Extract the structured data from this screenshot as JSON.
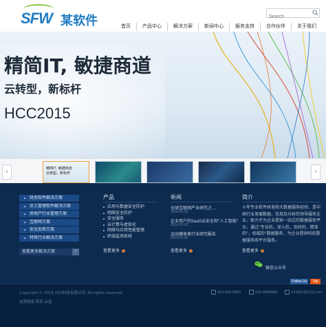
{
  "header": {
    "logo_text": "SFW",
    "brand_name": "某软件",
    "search_placeholder": "Search",
    "nav": [
      "首页",
      "产品中心",
      "解决方案",
      "新闻中心",
      "服务支持",
      "合作伙伴",
      "关于我们"
    ]
  },
  "banner": {
    "title": "精简IT, 敏捷商道",
    "subtitle": "云转型，新标杆",
    "code": "HCC2015"
  },
  "thumbnails": {
    "prev_label": "‹",
    "next_label": "›",
    "first_caption": [
      "精简IT, 敏捷商道",
      "云转型，新标杆"
    ]
  },
  "solutions": {
    "items": [
      "财务软件解决方案",
      "员工管理软件解决方案",
      "房地产行业管理方案",
      "互联网方案",
      "安全加密方案",
      "特殊行业解决方案"
    ],
    "more_label": "查看更多解决方案",
    "more_btn": "›"
  },
  "products": {
    "title": "产品",
    "items": [
      "应用与数据安全防护",
      "网络安全防护",
      "安全服务",
      "云计算与虚拟化",
      "网络与应用性能管理",
      "终端监测系统"
    ],
    "more_label": "查看更多"
  },
  "news": {
    "title": "新闻",
    "items": [
      {
        "title": "全球互联网产业研究之...",
        "date": "2016-01-02"
      },
      {
        "title": "企业用户的SaaS云安全和\"人工智能\"",
        "date": "2016-01-02"
      },
      {
        "title": "运动健身类行业研究报告",
        "date": "2016-01-02"
      }
    ],
    "more_label": "查看更多"
  },
  "intro": {
    "title": "简介",
    "text": "十年专业软件研发和大数据服务经验，是中国行业发展数据，信息及分析的领导服务企业，致力于为企业提供一站式的数据服务平台，通过\"专业的，深入的，及时的，精准的\"，权威的\"数据服务，为企业提供科技数据服务商平台服务。",
    "more_label": "查看更多",
    "wechat_label": "微信公众号"
  },
  "footer": {
    "follow_label": "Follow Us",
    "top_label": "Top",
    "copyright": "Copyright © 2016 XXX科技有限公司. All rights reserved",
    "links": "友情链接  首页  云监",
    "phone": "400-800-8800",
    "tel": "025-8888888",
    "email": "123456@123.com"
  },
  "colors": {
    "brand_blue": "#1f7cc2",
    "footer_navy": "#0d2a4f",
    "solution_blue": "#1b4a86",
    "top_orange": "#e05a1a"
  }
}
